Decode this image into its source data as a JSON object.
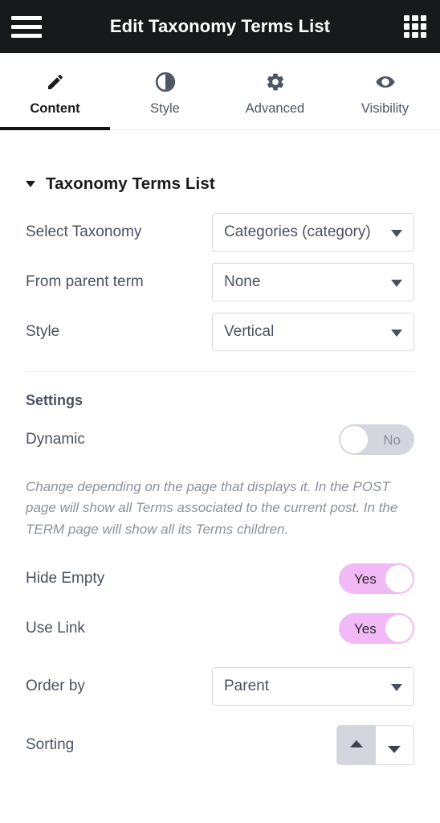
{
  "header": {
    "title": "Edit Taxonomy Terms List",
    "menu_icon": "hamburger-icon",
    "apps_icon": "grid-icon"
  },
  "tabs": [
    {
      "label": "Content",
      "icon": "pencil-icon",
      "active": true
    },
    {
      "label": "Style",
      "icon": "contrast-icon",
      "active": false
    },
    {
      "label": "Advanced",
      "icon": "gear-icon",
      "active": false
    },
    {
      "label": "Visibility",
      "icon": "eye-icon",
      "active": false
    }
  ],
  "section": {
    "title": "Taxonomy Terms List",
    "expanded": true
  },
  "fields": {
    "select_taxonomy": {
      "label": "Select Taxonomy",
      "value": "Categories (category)"
    },
    "from_parent_term": {
      "label": "From parent term",
      "value": "None"
    },
    "style": {
      "label": "Style",
      "value": "Vertical"
    },
    "order_by": {
      "label": "Order by",
      "value": "Parent"
    },
    "sorting": {
      "label": "Sorting",
      "ascending_selected": true
    }
  },
  "settings": {
    "title": "Settings",
    "dynamic": {
      "label": "Dynamic",
      "value": "No",
      "on": false
    },
    "dynamic_help": "Change depending on the page that displays it.\nIn the POST page will show all Terms associated to the current post.\nIn the TERM page will show all its Terms children.",
    "hide_empty": {
      "label": "Hide Empty",
      "value": "Yes",
      "on": true
    },
    "use_link": {
      "label": "Use Link",
      "value": "Yes",
      "on": true
    }
  },
  "colors": {
    "header_bg": "#18191b",
    "toggle_on": "#f1b9f6",
    "toggle_off": "#d3d6dc",
    "label_text": "#4a5160",
    "border": "#d8dade",
    "active_tab_underline": "#111213"
  }
}
